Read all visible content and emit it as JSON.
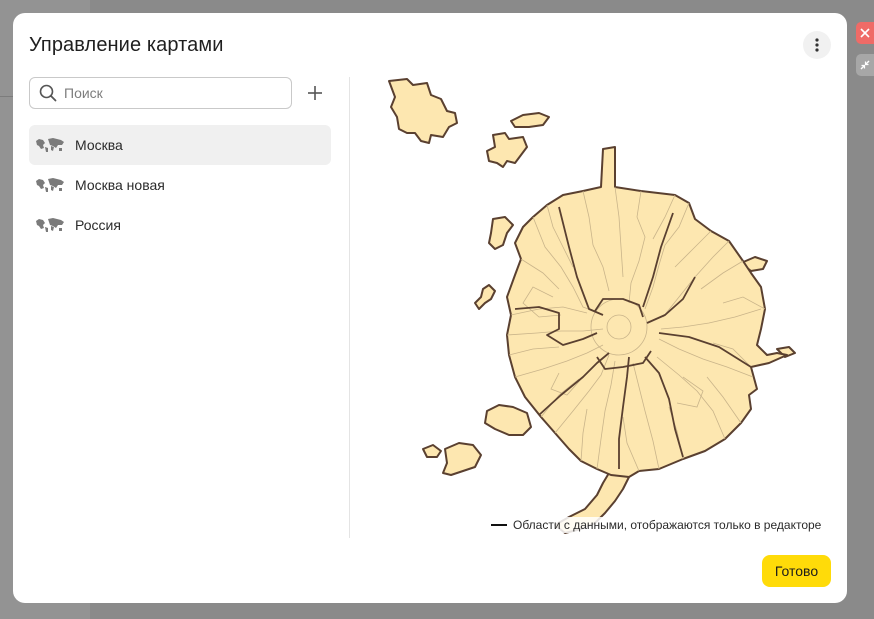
{
  "dialog": {
    "title": "Управление картами",
    "done_label": "Готово"
  },
  "search": {
    "placeholder": "Поиск",
    "value": ""
  },
  "maps": [
    {
      "label": "Москва",
      "selected": true
    },
    {
      "label": "Москва новая",
      "selected": false
    },
    {
      "label": "Россия",
      "selected": false
    }
  ],
  "legend": {
    "text": "Области с данными, отображаются только в редакторе"
  },
  "icons": {
    "more": "more-vertical-icon",
    "search": "search-icon",
    "add": "plus-icon",
    "map_item": "world-map-icon",
    "close": "close-icon",
    "expand": "collapse-icon"
  },
  "colors": {
    "accent_button": "#ffdb09",
    "map_fill": "#fde7b0",
    "map_outline": "#5a4030",
    "selected_item": "#f0f0f0",
    "close_button": "#ef6b67"
  }
}
